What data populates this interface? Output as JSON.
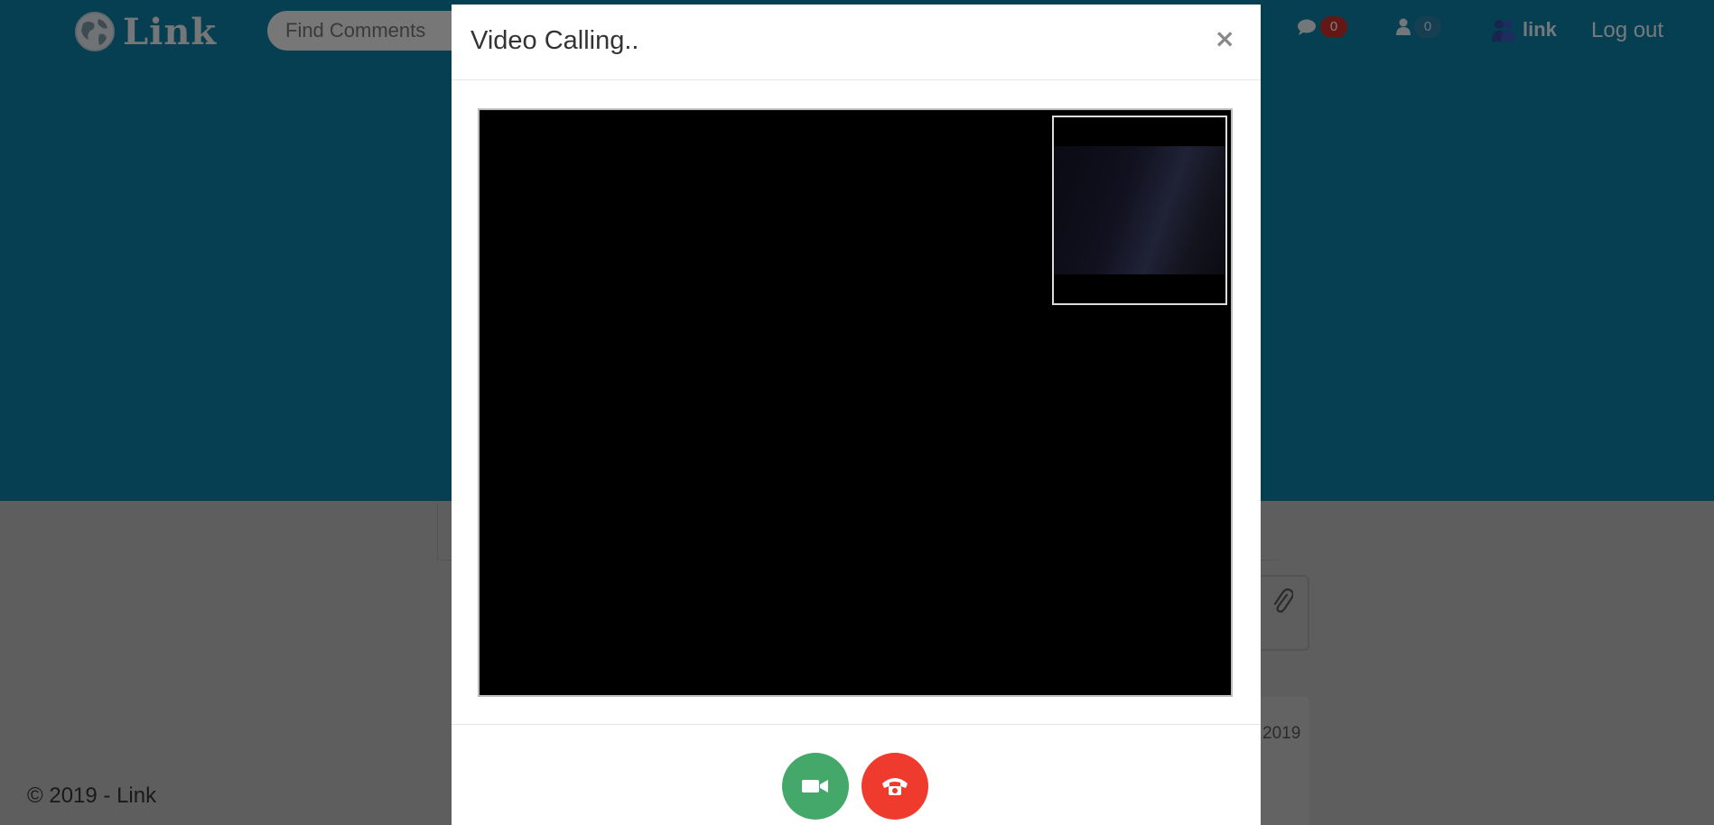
{
  "navbar": {
    "brand": "Link",
    "search_placeholder": "Find Comments",
    "comments_count": "0",
    "users_count": "0",
    "user_link": "link",
    "logout": "Log out"
  },
  "background": {
    "date_fragment": "2019"
  },
  "footer": {
    "copyright": "© 2019 - Link"
  },
  "modal": {
    "title": "Video Calling..",
    "close": "×"
  },
  "icons": {
    "brand": "globe-icon",
    "comments": "comment-icon",
    "users": "user-icon",
    "user_link": "people-icon",
    "video": "video-camera-icon",
    "hangup": "phone-icon",
    "attach": "paperclip-icon"
  },
  "colors": {
    "hero": "#0d7fa3",
    "video_button": "#45a86b",
    "hangup_button": "#ee3b2d",
    "badge_red": "#c9302c"
  }
}
